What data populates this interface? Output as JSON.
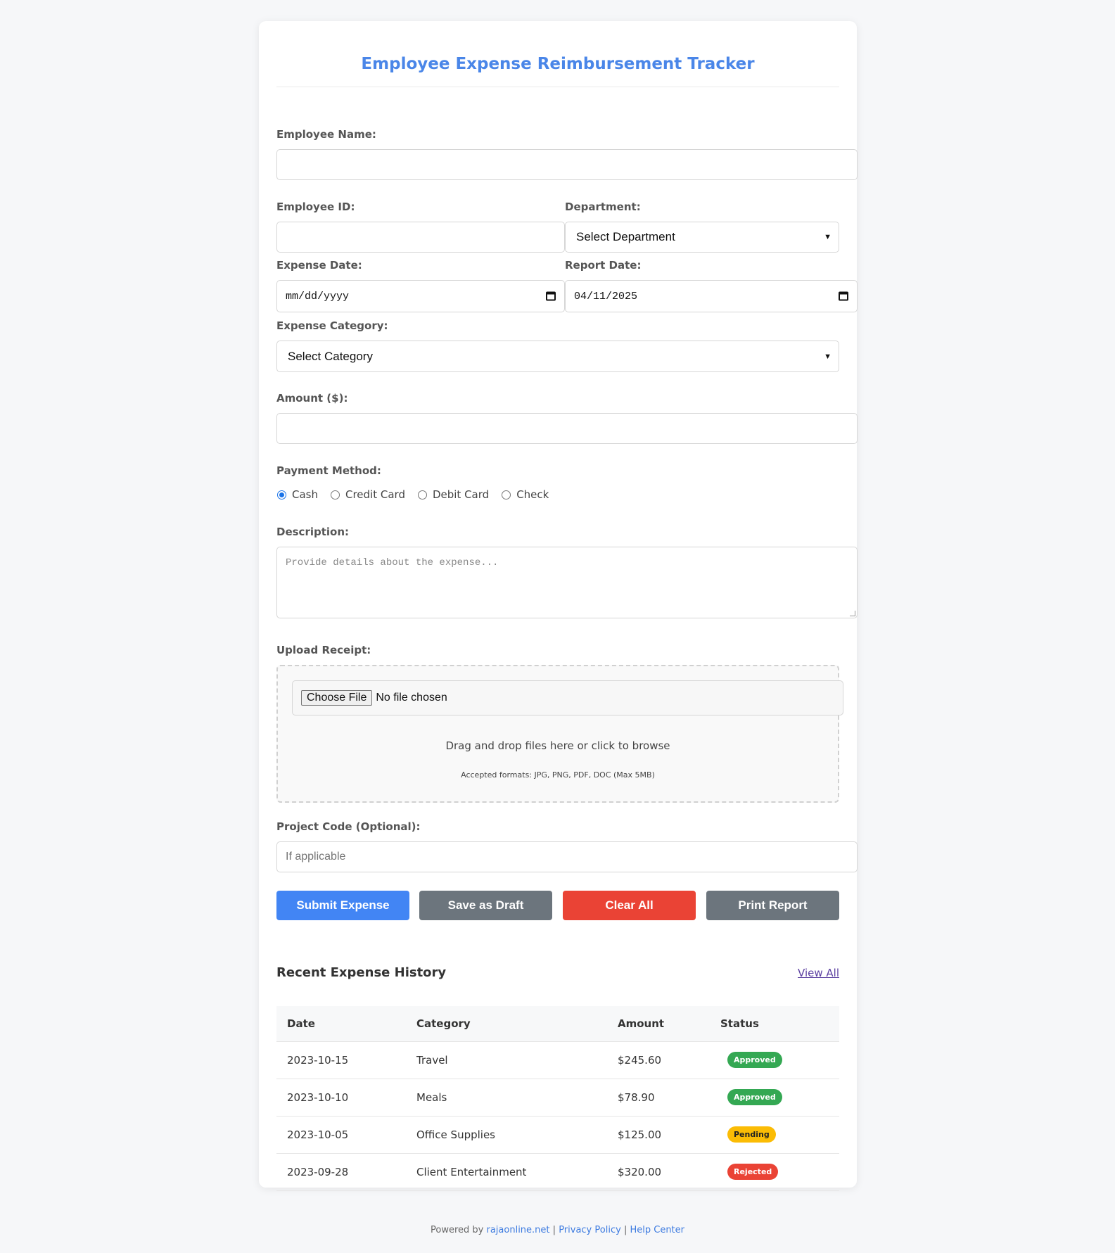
{
  "page": {
    "title": "Employee Expense Reimbursement Tracker"
  },
  "form": {
    "employee_name_label": "Employee Name:",
    "employee_name_value": "",
    "employee_id_label": "Employee ID:",
    "employee_id_value": "",
    "department_label": "Department:",
    "department_selected": "Select Department",
    "expense_date_label": "Expense Date:",
    "expense_date_value": "mm/dd/yyyy",
    "report_date_label": "Report Date:",
    "report_date_value": "04/11/2025",
    "expense_category_label": "Expense Category:",
    "expense_category_selected": "Select Category",
    "amount_label": "Amount ($):",
    "amount_value": "",
    "payment_method_label": "Payment Method:",
    "payment_methods": [
      {
        "label": "Cash",
        "checked": true
      },
      {
        "label": "Credit Card",
        "checked": false
      },
      {
        "label": "Debit Card",
        "checked": false
      },
      {
        "label": "Check",
        "checked": false
      }
    ],
    "description_label": "Description:",
    "description_placeholder": "Provide details about the expense...",
    "upload_label": "Upload Receipt:",
    "choose_file_label": "Choose File",
    "no_file_text": "No file chosen",
    "dropzone_text": "Drag and drop files here or click to browse",
    "dropzone_formats": "Accepted formats: JPG, PNG, PDF, DOC (Max 5MB)",
    "project_code_label": "Project Code (Optional):",
    "project_code_placeholder": "If applicable"
  },
  "actions": {
    "submit": "Submit Expense",
    "draft": "Save as Draft",
    "clear": "Clear All",
    "print": "Print Report"
  },
  "colors": {
    "accent": "#4285f4",
    "gray_button": "#6c757d",
    "danger": "#ea4335",
    "approved": "#34a853",
    "pending": "#fbbc05",
    "rejected": "#ea4335"
  },
  "history": {
    "title": "Recent Expense History",
    "view_all": "View All",
    "columns": [
      "Date",
      "Category",
      "Amount",
      "Status"
    ],
    "rows": [
      {
        "date": "2023-10-15",
        "category": "Travel",
        "amount": "$245.60",
        "status": "Approved"
      },
      {
        "date": "2023-10-10",
        "category": "Meals",
        "amount": "$78.90",
        "status": "Approved"
      },
      {
        "date": "2023-10-05",
        "category": "Office Supplies",
        "amount": "$125.00",
        "status": "Pending"
      },
      {
        "date": "2023-09-28",
        "category": "Client Entertainment",
        "amount": "$320.00",
        "status": "Rejected"
      }
    ]
  },
  "footer": {
    "powered_by": "Powered by",
    "site_link": "rajaonline.net",
    "privacy_link": "Privacy Policy",
    "help_link": "Help Center",
    "separator": "|"
  }
}
